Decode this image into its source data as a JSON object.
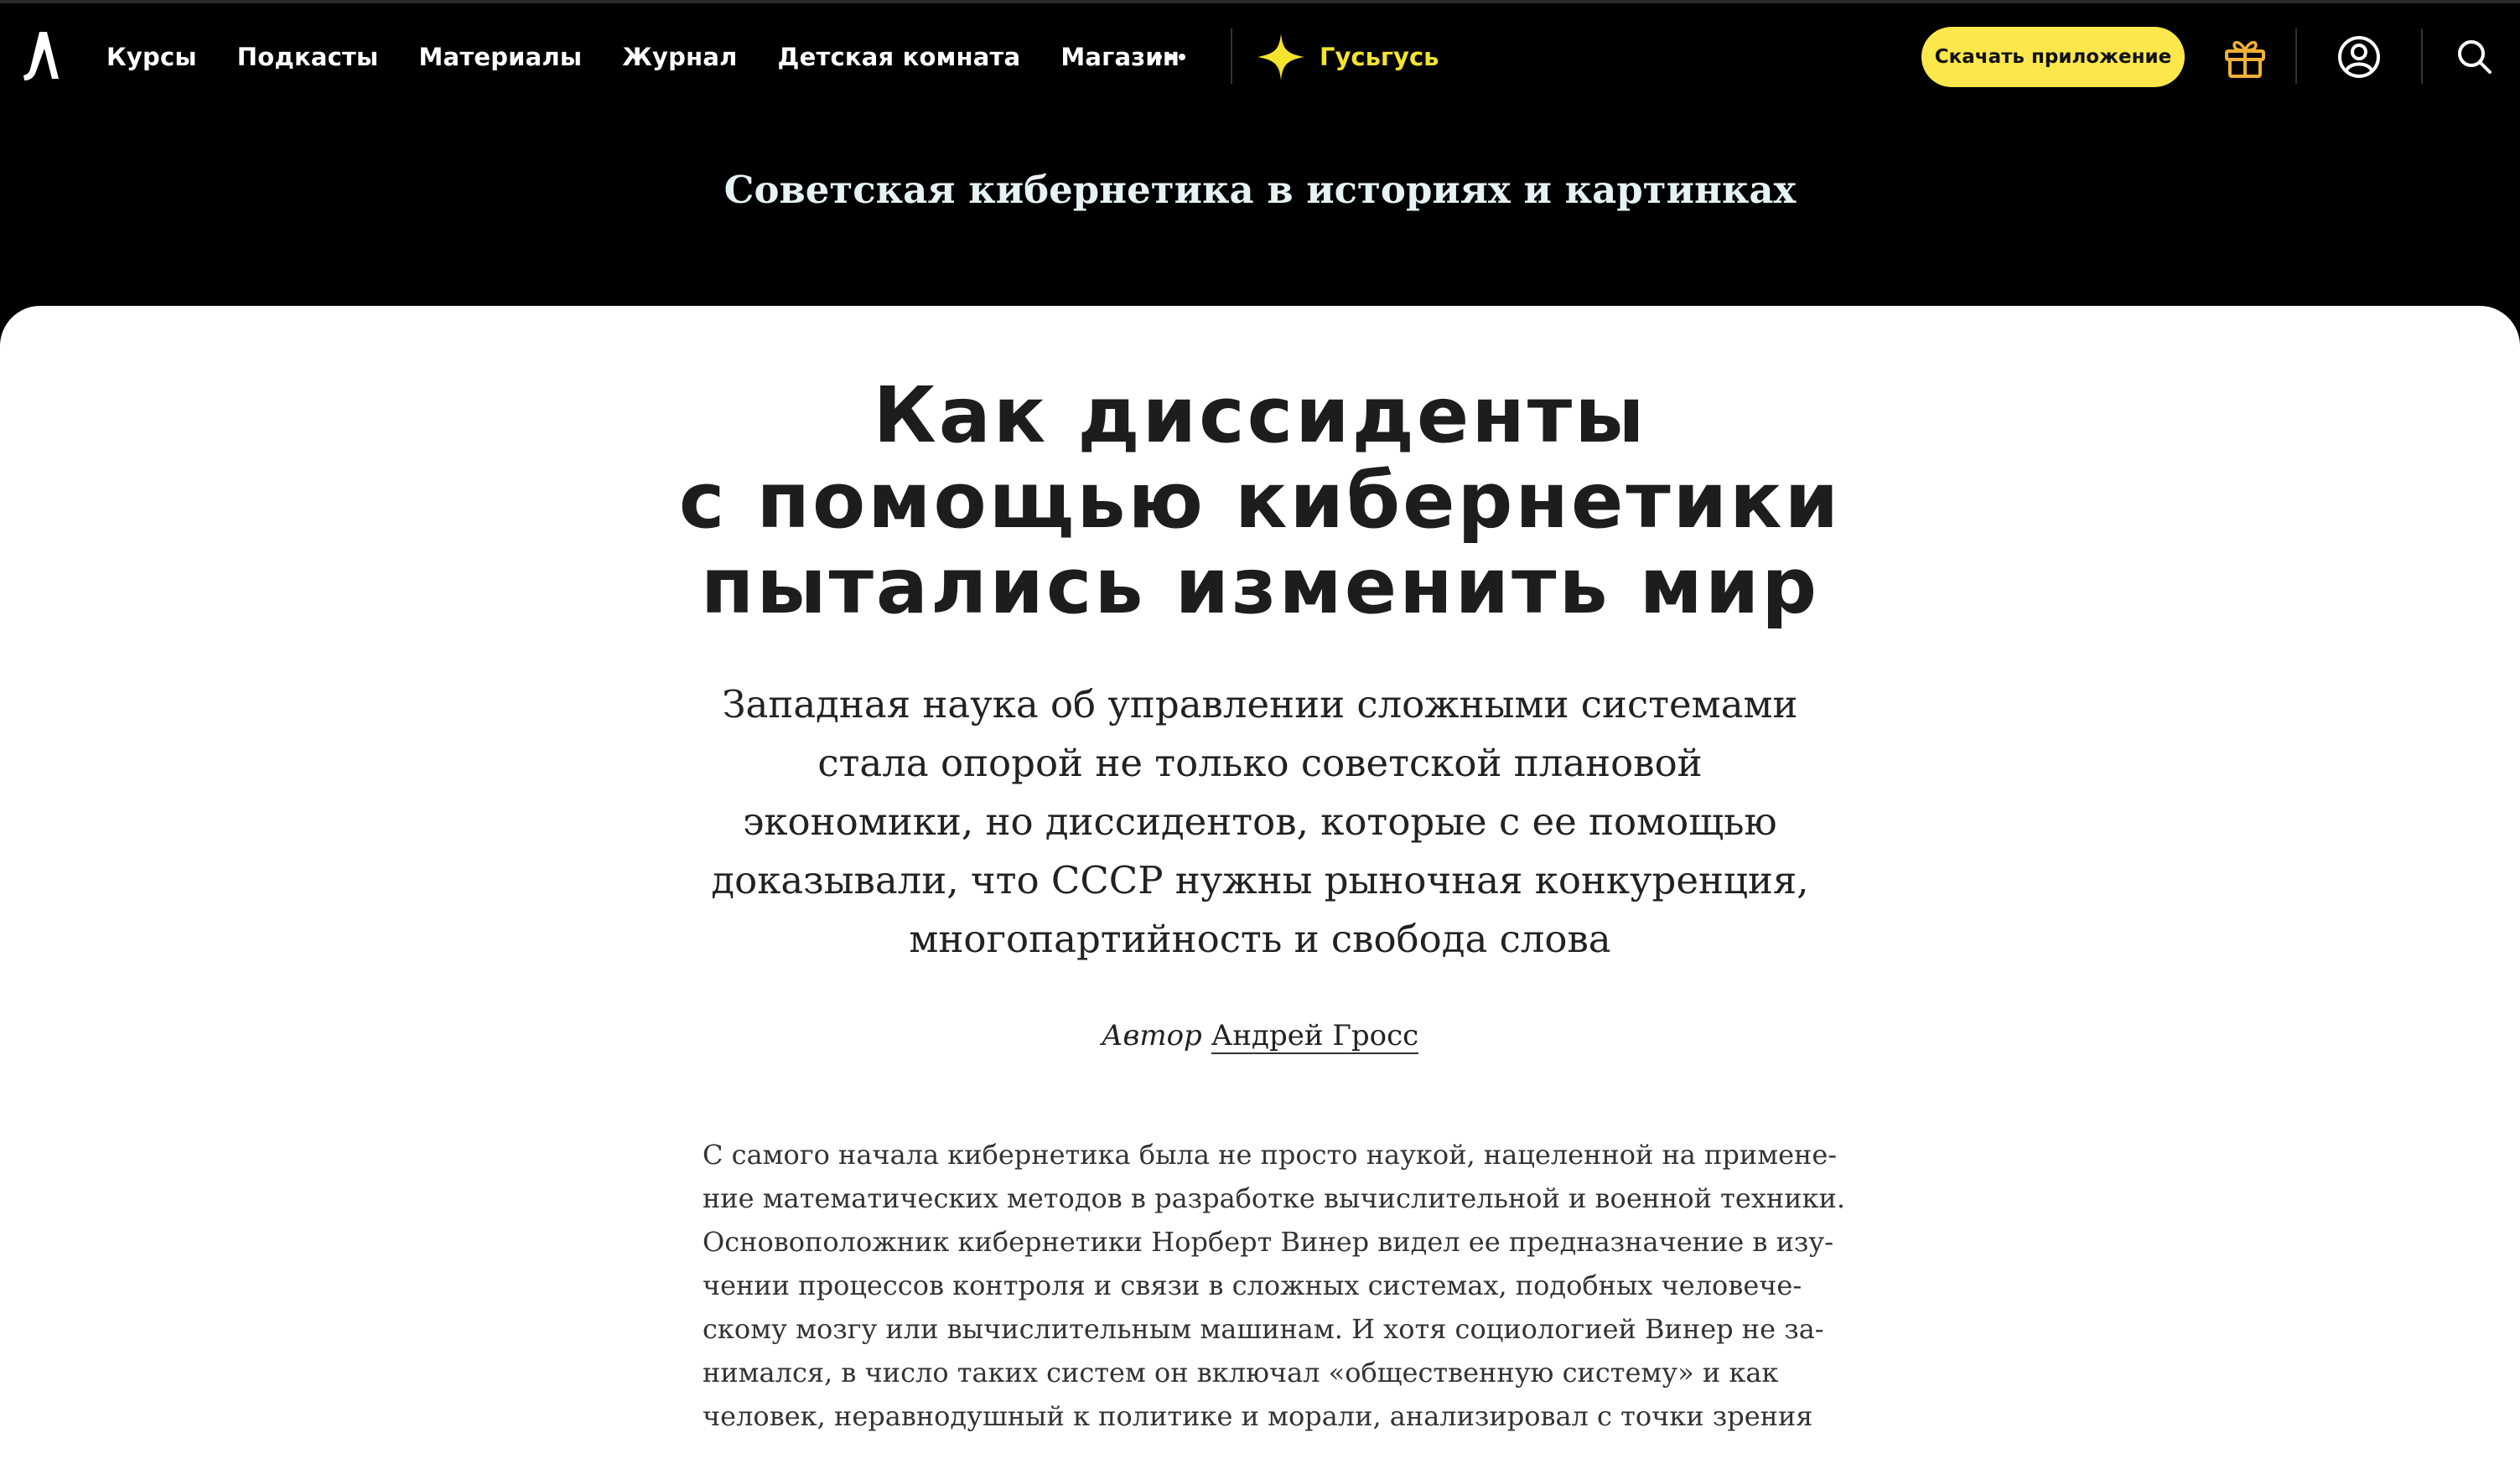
{
  "nav": {
    "items": [
      "Курсы",
      "Подкасты",
      "Материалы",
      "Журнал",
      "Детская комната",
      "Магазин"
    ],
    "more_icon": "ellipsis-icon",
    "goose_label": "Гусьгусь",
    "goose_icon": "sparkle-icon",
    "download_label": "Скачать приложение",
    "icons": [
      "gift-icon",
      "user-icon",
      "search-icon"
    ]
  },
  "article": {
    "series": "Советская кибернетика в историях и картинках",
    "title_lines": [
      "Как диссиденты",
      "с помощью кибернетики",
      "пытались изменить мир"
    ],
    "lead_lines": [
      "Западная наука об управлении сложными системами",
      "стала опорой не только советской плановой",
      "экономики, но диссидентов, которые с ее помощью",
      "доказывали, что СССР нужны рыночная конкуренция,",
      "многопартийность и свобода слова"
    ],
    "byline_label": "Автор",
    "author": "Андрей Гросс",
    "body_lines": [
      "С самого начала кибернетика была не просто наукой, нацеленной на примене-",
      "ние математических методов в разработке вычислительной и военной техники.",
      "Основоположник кибернетики Норберт Винер видел ее предназначение в изу-",
      "чении процессов контроля и связи в сложных системах, подобных человече-",
      "скому мозгу или вычислительным машинам. И хотя социологией Винер не за-",
      "нимался, в число таких систем он включал «общественную систему» и как",
      "человек, неравнодушный к политике и морали, анализировал с точки зрения"
    ]
  },
  "colors": {
    "accent_yellow": "#fde74c",
    "goose_yellow": "#f5e32e",
    "series_text": "#e6f3f4",
    "header_bg": "#000000",
    "gift_icon": "#f2b134"
  }
}
